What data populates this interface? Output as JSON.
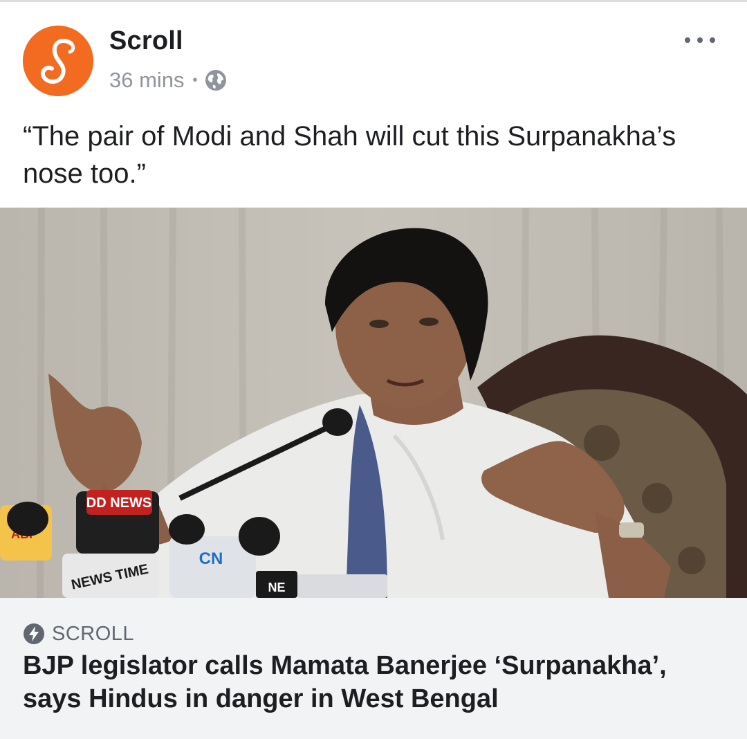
{
  "post": {
    "page_name": "Scroll",
    "timestamp": "36 mins",
    "separator": "•",
    "privacy_icon": "globe-icon",
    "more_icon": "more-options-icon",
    "caption": "“The pair of Modi and Shah will cut this Surpanakha’s nose too.”"
  },
  "link_preview": {
    "source_icon": "instant-article-bolt-icon",
    "source": "SCROLL",
    "headline": "BJP legislator calls Mamata Banerjee ‘Surpanakha’, says Hindus in danger in West Bengal",
    "photo_mic_labels": [
      "DD NEWS",
      "ABP",
      "NEWS TIME",
      "CN",
      "NE"
    ]
  },
  "colors": {
    "brand": "#f26b21",
    "text_primary": "#1c1e21",
    "text_secondary": "#90949c",
    "link_bg": "#f2f3f5"
  }
}
